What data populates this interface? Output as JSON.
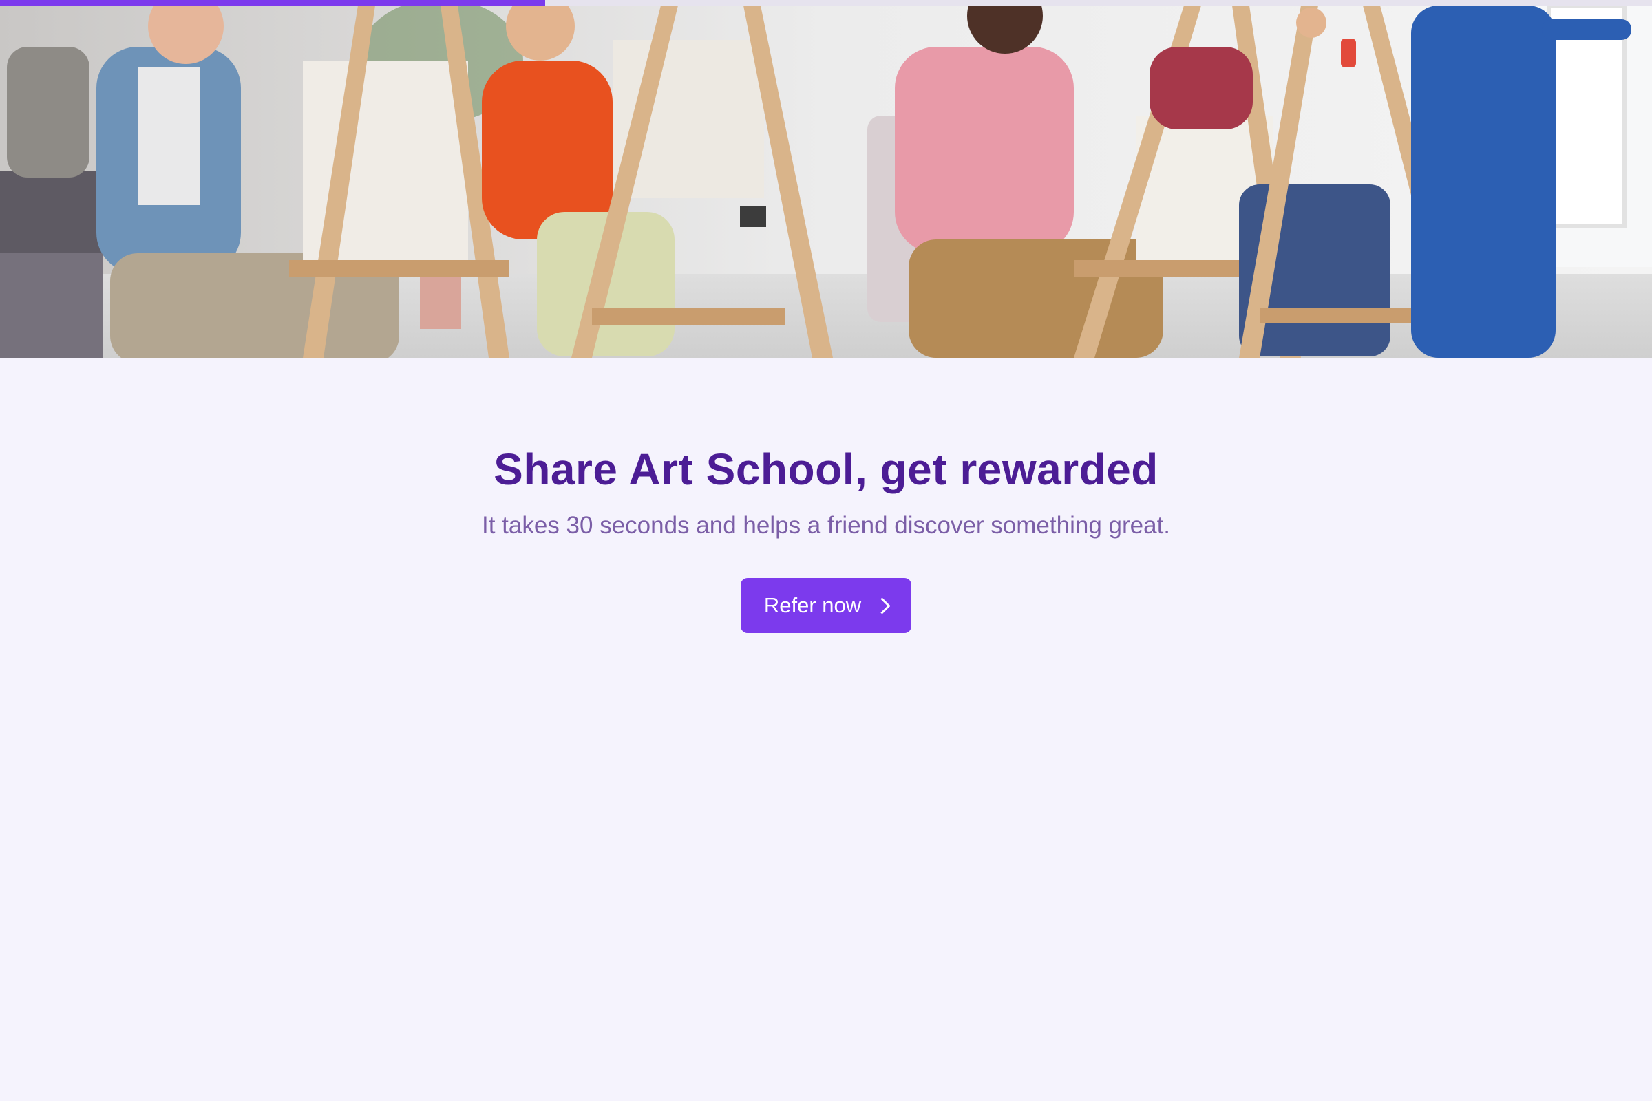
{
  "progress": {
    "fraction": 0.33,
    "color": "#7c3aed"
  },
  "hero": {
    "image_subject": "kids-at-easels-art-class-photo"
  },
  "headline": "Share Art School, get rewarded",
  "subheadline": "It takes 30 seconds and helps a friend discover something great.",
  "cta": {
    "label": "Refer now",
    "icon": "chevron-right-icon",
    "color": "#7c3aed"
  },
  "colors": {
    "background": "#f5f3fd",
    "headline": "#4c1d95",
    "subheadline": "#7b5ea7"
  }
}
